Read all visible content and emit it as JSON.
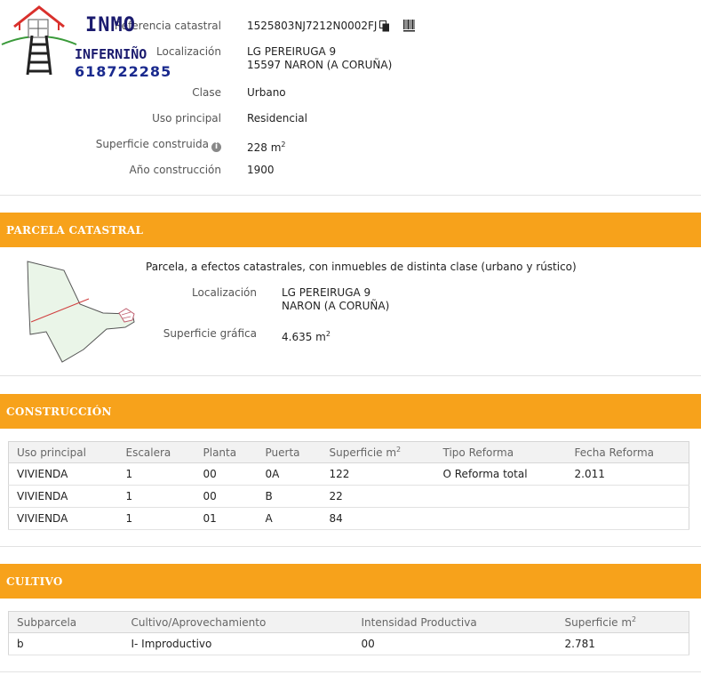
{
  "logo": {
    "top_word": "INMO",
    "name": "INFERNIÑO",
    "phone": "618722285"
  },
  "info": {
    "ref_label": "Referencia catastral",
    "ref_value": "1525803NJ7212N0002FJ",
    "loc_label": "Localización",
    "loc_line1": "LG PEREIRUGA 9",
    "loc_line2": "15597 NARON (A CORUÑA)",
    "clase_label": "Clase",
    "clase_value": "Urbano",
    "uso_label": "Uso principal",
    "uso_value": "Residencial",
    "sup_label": "Superficie construida",
    "sup_value": "228 m",
    "sup_unit_exp": "2",
    "anio_label": "Año construcción",
    "anio_value": "1900"
  },
  "parcela": {
    "header": "PARCELA CATASTRAL",
    "description": "Parcela, a efectos catastrales, con inmuebles de distinta clase (urbano y rústico)",
    "loc_label": "Localización",
    "loc_line1": "LG PEREIRUGA 9",
    "loc_line2": "NARON (A CORUÑA)",
    "sup_label": "Superficie gráfica",
    "sup_value": "4.635 m",
    "sup_unit_exp": "2"
  },
  "construccion": {
    "header": "CONSTRUCCIÓN",
    "columns": [
      "Uso principal",
      "Escalera",
      "Planta",
      "Puerta",
      "Superficie m",
      "Tipo Reforma",
      "Fecha Reforma"
    ],
    "sup_exp": "2",
    "rows": [
      [
        "VIVIENDA",
        "1",
        "00",
        "0A",
        "122",
        "O Reforma total",
        "2.011"
      ],
      [
        "VIVIENDA",
        "1",
        "00",
        "B",
        "22",
        "",
        ""
      ],
      [
        "VIVIENDA",
        "1",
        "01",
        "A",
        "84",
        "",
        ""
      ]
    ]
  },
  "cultivo": {
    "header": "CULTIVO",
    "columns": [
      "Subparcela",
      "Cultivo/Aprovechamiento",
      "Intensidad Productiva",
      "Superficie m"
    ],
    "sup_exp": "2",
    "rows": [
      [
        "b",
        "I- Improductivo",
        "00",
        "2.781"
      ]
    ]
  },
  "colors": {
    "section_header": "#f7a21b",
    "logo_text": "#1a1a6e",
    "logo_roof": "#d9302c",
    "logo_ladder": "#2a2a2a",
    "logo_arc": "#3a9a3a"
  },
  "icons": [
    "copy-icon",
    "barcode-icon",
    "info-icon",
    "house-logo-icon"
  ]
}
